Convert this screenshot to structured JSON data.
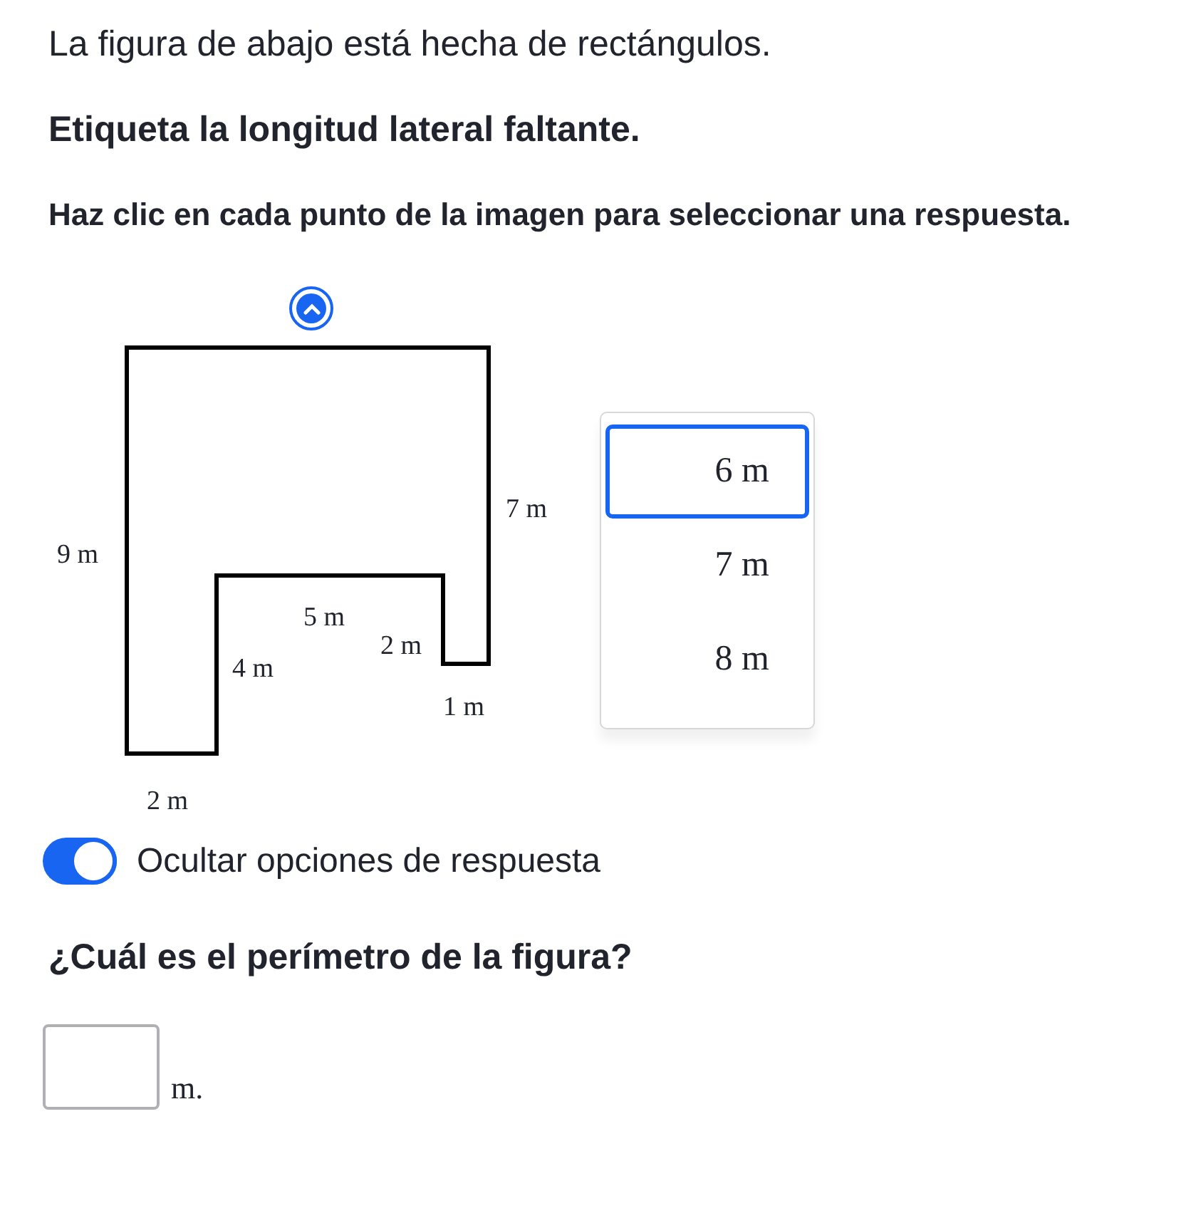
{
  "intro": "La figura de abajo está hecha de rectángulos.",
  "instruction": "Etiqueta la longitud lateral faltante.",
  "hint": "Haz clic en cada punto de la imagen para seleccionar una respuesta.",
  "figure": {
    "hotspot": {
      "expanded": true
    },
    "side_labels": [
      "9 m",
      "7 m",
      "5 m",
      "2 m",
      "4 m",
      "1 m",
      "2 m"
    ]
  },
  "dropdown": {
    "options": [
      {
        "label": "6 m",
        "selected": true
      },
      {
        "label": "7 m",
        "selected": false
      },
      {
        "label": "8 m",
        "selected": false
      }
    ]
  },
  "toggle": {
    "label": "Ocultar opciones de respuesta",
    "on": true
  },
  "question": "¿Cuál es el perímetro de la figura?",
  "answer": {
    "unit": "m."
  }
}
